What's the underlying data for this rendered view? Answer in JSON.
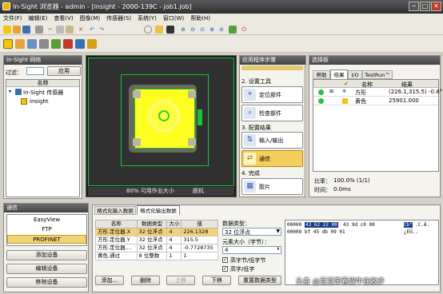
{
  "window": {
    "title": "In-Sight 浏览器 - admin - [insight - 2000-139C - job1.job]",
    "min": "─",
    "max": "□",
    "close": "✕"
  },
  "menu": [
    "文件(F)",
    "编辑(E)",
    "查看(V)",
    "图像(M)",
    "传感器(S)",
    "系统(Y)",
    "窗口(W)",
    "帮助(H)"
  ],
  "network_panel": {
    "title": "In-Sight 网络",
    "filter_label": "过滤：",
    "filter_value": "",
    "apply": "应用",
    "col_name": "名称",
    "tree_root": "In-Sight 传感器",
    "tree_child": "insight"
  },
  "comm_panel": {
    "title": "通信",
    "options": [
      "EasyView",
      "FTP",
      "PROFINET"
    ],
    "selected": "PROFINET",
    "buttons": [
      "添加设备",
      "编辑设备",
      "移除设备"
    ]
  },
  "image": {
    "status": "80% 可用作业大小",
    "mode": "脱机"
  },
  "steps": {
    "title": "应用程序步骤",
    "sect2": "2. 设置工具",
    "sect3": "3. 配置结果",
    "sect4": "4. 完成",
    "items": [
      {
        "label": "定位部件",
        "icon": "locate-icon"
      },
      {
        "label": "检查部件",
        "icon": "inspect-icon"
      },
      {
        "label": "输入/输出",
        "icon": "io-icon"
      },
      {
        "label": "通信",
        "icon": "comm-icon"
      },
      {
        "label": "胶片",
        "icon": "film-icon"
      }
    ]
  },
  "palette": {
    "title": "选择板",
    "tabs": [
      "帮助",
      "结果",
      "I/O",
      "TestRun™"
    ],
    "active_tab": "结果",
    "col_name": "名称",
    "col_result": "结果",
    "rows": [
      {
        "name": "方形",
        "result": "(226.1,315.5) -0.8°",
        "status": "pass"
      },
      {
        "name": "黄色",
        "result": "25901.000",
        "status": "pass"
      }
    ],
    "ratio_label": "比率：",
    "ratio_value": "100.0% (1/1)",
    "time_label": "时间：",
    "time_value": "0.0ms"
  },
  "format": {
    "tabs": [
      "格式化输入数据",
      "格式化输出数据"
    ],
    "active_tab": "格式化输出数据",
    "columns": [
      "名称",
      "数据类型",
      "大小",
      "值"
    ],
    "rows": [
      {
        "name": "方形.定位器.X",
        "type": "32 位浮点",
        "size": "4",
        "value": "226.1328"
      },
      {
        "name": "方形.定位器.Y",
        "type": "32 位浮点",
        "size": "4",
        "value": "315.5"
      },
      {
        "name": "方形.定位器.…",
        "type": "32 位浮点",
        "size": "4",
        "value": "-0.7728735"
      },
      {
        "name": "黄色.通过",
        "type": "8 位整数",
        "size": "1",
        "value": "1"
      }
    ],
    "buttons": {
      "add": "添加...",
      "delete": "删除",
      "up": "上移",
      "down": "下移",
      "reset": "重置数据类型"
    },
    "dtype_label": "数据类型：",
    "dtype_value": "32 位浮点",
    "elemsize_label": "元素大小（字节）：",
    "elemsize_value": "4",
    "cb1": "高字节/低字节",
    "cb2": "高字/低字",
    "hex_lines": [
      {
        "addr": "00000",
        "b1": "43 62 22 00",
        "b2": "43 9d c0 00",
        "ascii1": "Cb\"",
        "ascii2": ".C.À."
      },
      {
        "addr": "00008",
        "b1": "bf 45 db 09 01",
        "b2": "",
        "ascii1": "¿EÛ..",
        "ascii2": ""
      }
    ]
  },
  "watermark": "头条 @豆豆笨看蜗牛在散步"
}
